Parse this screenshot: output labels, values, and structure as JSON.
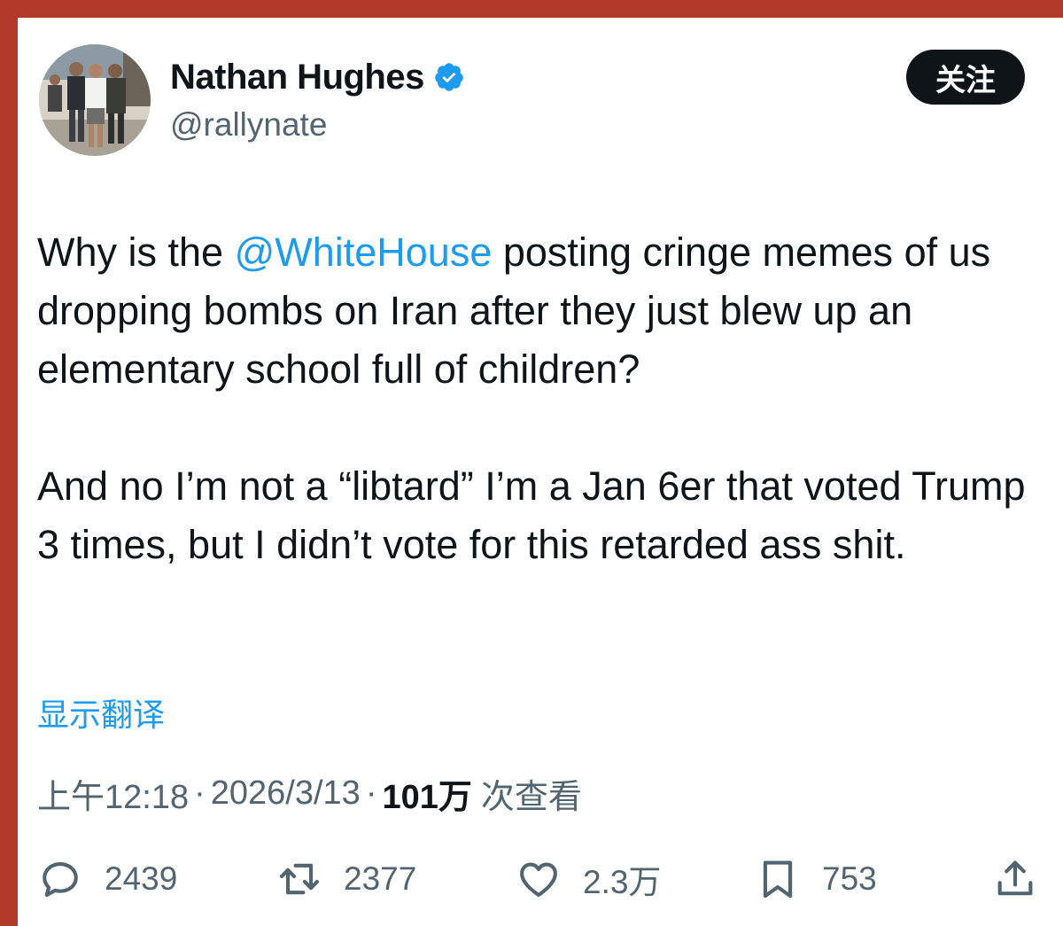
{
  "header": {
    "display_name": "Nathan Hughes",
    "handle": "@rallynate",
    "follow_label": "关注"
  },
  "tweet": {
    "para1_before": "Why is the ",
    "mention": "@WhiteHouse",
    "para1_after": " posting cringe memes of us dropping bombs on Iran after they just blew up an elementary school full of children?",
    "para2": "And no I’m not a “libtard” I’m a Jan 6er that voted Trump 3 times, but I didn’t vote for this retarded ass shit."
  },
  "translate_label": "显示翻译",
  "meta": {
    "time": "上午12:18",
    "separator": "·",
    "date": "2026/3/13",
    "views_count": "101万",
    "views_label": "次查看"
  },
  "actions": {
    "replies": "2439",
    "reposts": "2377",
    "likes": "2.3万",
    "bookmarks": "753"
  },
  "colors": {
    "frame": "#b23a2a",
    "text": "#0f1419",
    "secondary": "#536471",
    "link": "#1d9bf0"
  }
}
